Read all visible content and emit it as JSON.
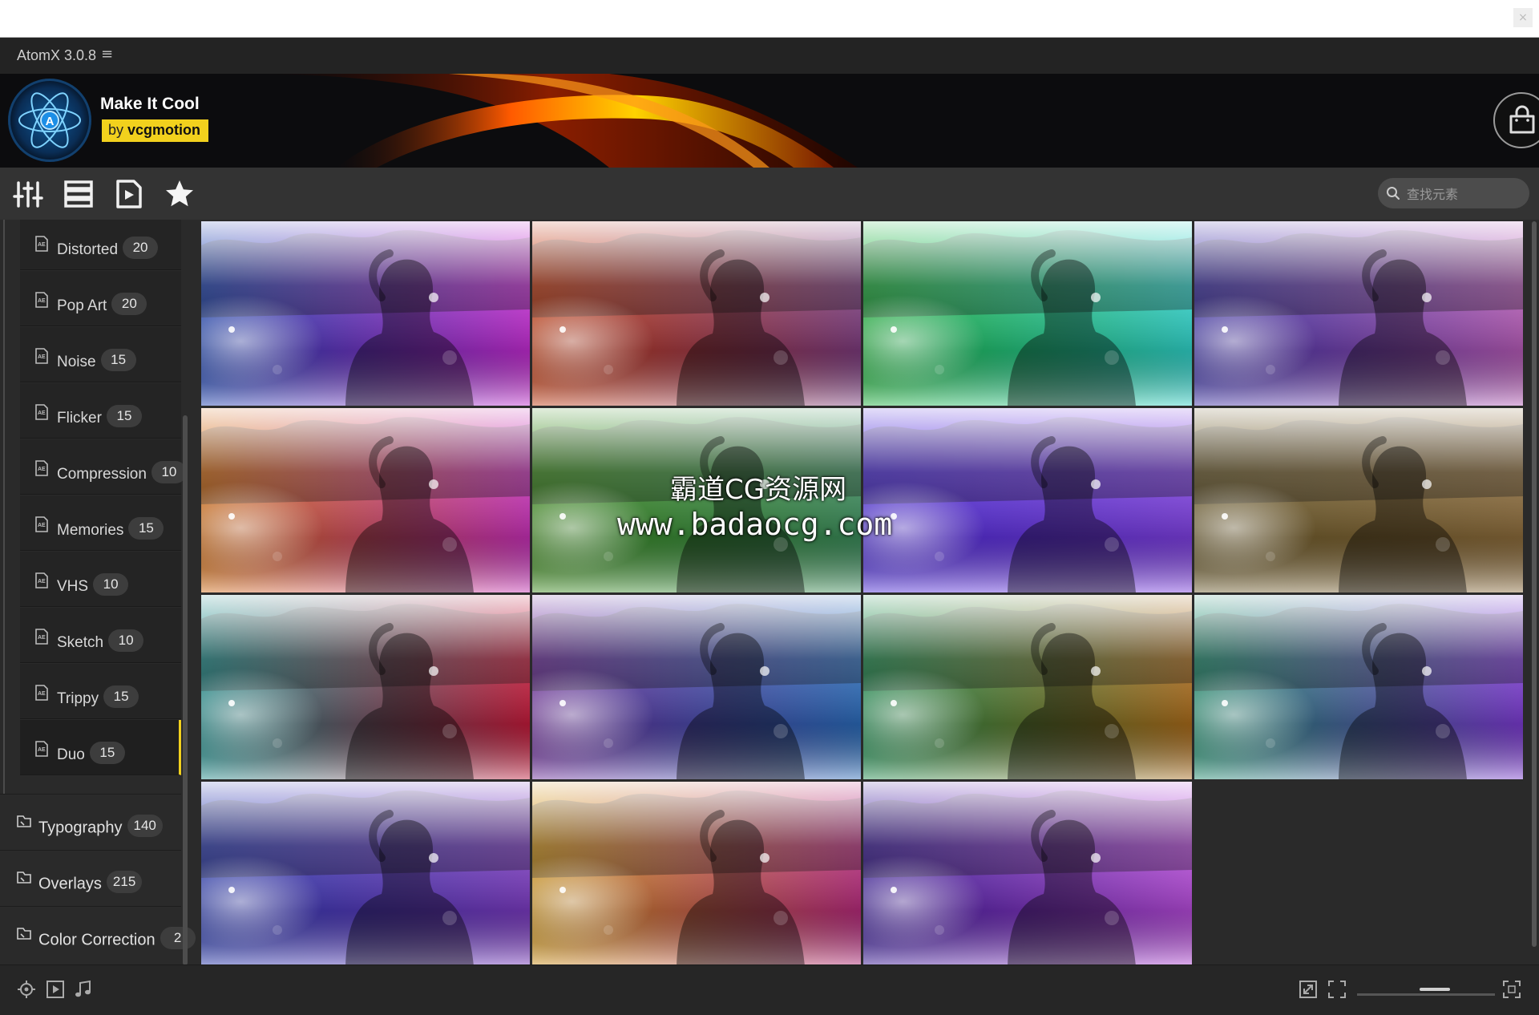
{
  "window": {
    "title": "AtomX 3.0.8",
    "menu_glyph": "≡",
    "close_glyph": "×"
  },
  "banner": {
    "pack_name": "Make It Cool",
    "by_prefix": "by",
    "author": "vcgmotion"
  },
  "toolbar": {
    "search_placeholder": "查找元素"
  },
  "sidebar": {
    "subitems": [
      {
        "label": "Distorted",
        "count": "20"
      },
      {
        "label": "Pop Art",
        "count": "20"
      },
      {
        "label": "Noise",
        "count": "15"
      },
      {
        "label": "Flicker",
        "count": "15"
      },
      {
        "label": "Compression",
        "count": "10"
      },
      {
        "label": "Memories",
        "count": "15"
      },
      {
        "label": "VHS",
        "count": "10"
      },
      {
        "label": "Sketch",
        "count": "10"
      },
      {
        "label": "Trippy",
        "count": "15"
      },
      {
        "label": "Duo",
        "count": "15"
      }
    ],
    "active_index": 9,
    "categories": [
      {
        "label": "Typography",
        "count": "140"
      },
      {
        "label": "Overlays",
        "count": "215"
      },
      {
        "label": "Color Correction",
        "count": "2"
      }
    ]
  },
  "grid": {
    "tiles": [
      {
        "c1": "#1a3fb0",
        "c2": "#c12bd0"
      },
      {
        "c1": "#c33a10",
        "c2": "#7b3a7c"
      },
      {
        "c1": "#1bb23a",
        "c2": "#2fd1c8"
      },
      {
        "c1": "#3a2fa6",
        "c2": "#b45ab6"
      },
      {
        "c1": "#d26a10",
        "c2": "#c52fb5"
      },
      {
        "c1": "#3a8a1a",
        "c2": "#3a8a5a"
      },
      {
        "c1": "#4a2ad9",
        "c2": "#7d3fe0"
      },
      {
        "c1": "#6b5a2a",
        "c2": "#8a6a3a"
      },
      {
        "c1": "#1a8a88",
        "c2": "#c21a3a"
      },
      {
        "c1": "#6a2a9a",
        "c2": "#2a6ab8"
      },
      {
        "c1": "#1a8a4a",
        "c2": "#a86a1a"
      },
      {
        "c1": "#1a8a6a",
        "c2": "#7a3ad0"
      },
      {
        "c1": "#2a3ab0",
        "c2": "#7a3ac0"
      },
      {
        "c1": "#d2951a",
        "c2": "#b42a7a"
      },
      {
        "c1": "#3a1a9a",
        "c2": "#b44ad8"
      }
    ]
  },
  "watermark": {
    "line1": "霸道CG资源网",
    "line2": "www.badaocg.com"
  },
  "icons": [
    "atomx-logo-icon",
    "shopping-bag-icon",
    "sliders-icon",
    "list-icon",
    "video-icon",
    "star-icon",
    "search-icon",
    "ae-file-icon",
    "folder-icon",
    "target-icon",
    "media-icon",
    "music-icon",
    "fit-icon",
    "expand-icon",
    "fullscreen-icon"
  ],
  "colors": {
    "accent": "#f2d11d",
    "background": "#2a2a2a"
  }
}
